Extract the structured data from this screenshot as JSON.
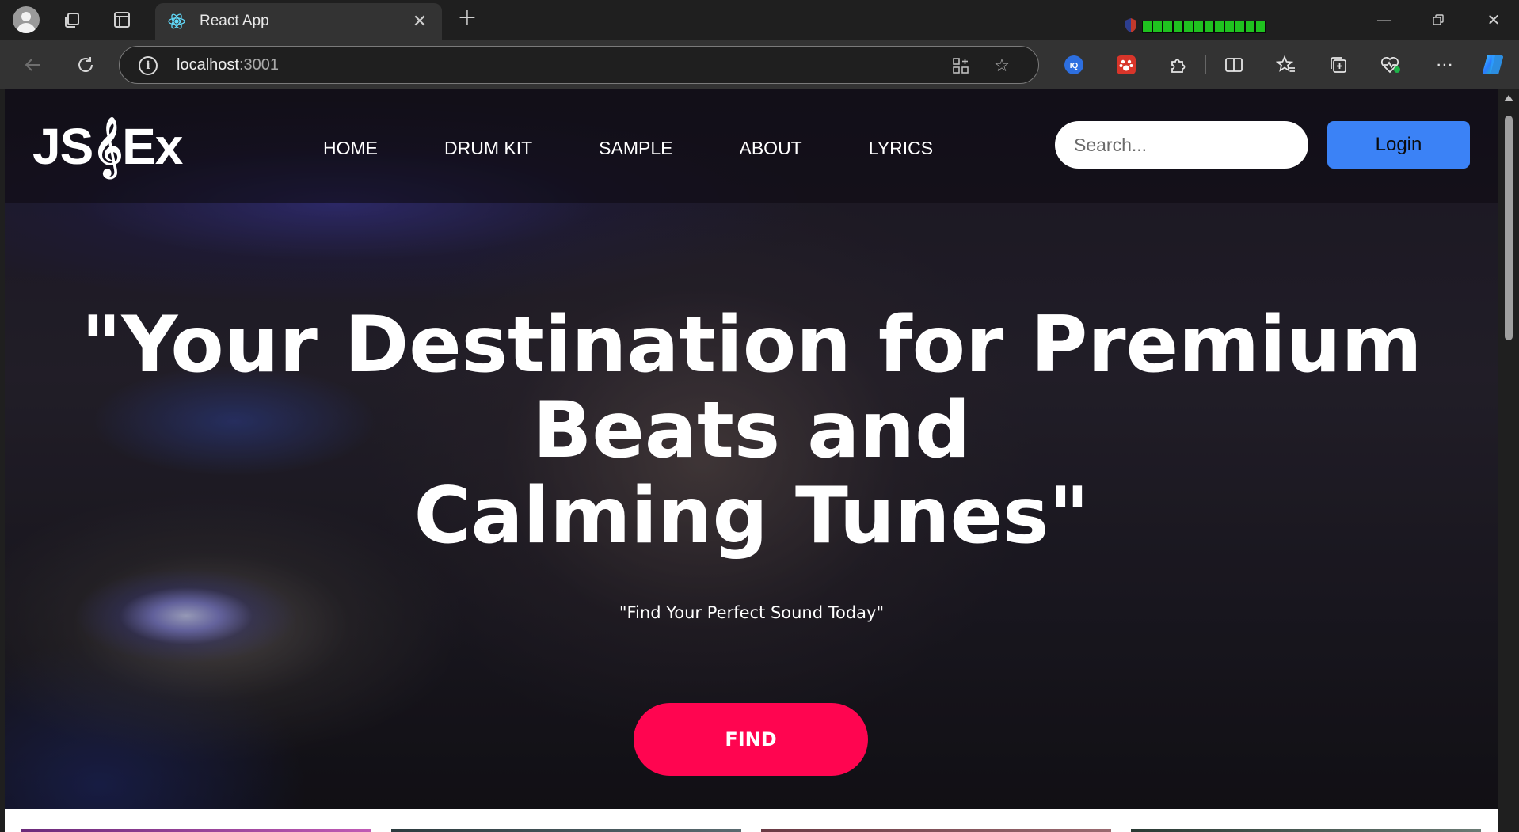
{
  "browser": {
    "tab_title": "React App",
    "url_host": "localhost",
    "url_port": ":3001",
    "icons": [
      "profile-icon",
      "workspaces-icon",
      "tab-actions-icon",
      "react-favicon-icon",
      "close-icon",
      "new-tab-icon",
      "minimize-icon",
      "restore-icon",
      "window-close-icon",
      "back-icon",
      "refresh-icon",
      "info-icon",
      "app-install-icon",
      "favorite-star-icon",
      "extension-iq-icon",
      "extension-paw-icon",
      "extensions-puzzle-icon",
      "split-screen-icon",
      "favorites-icon",
      "collections-icon",
      "browser-health-icon",
      "more-icon",
      "copilot-icon"
    ]
  },
  "page": {
    "logo": "JS𝄞Ex",
    "nav": [
      "HOME",
      "DRUM KIT",
      "SAMPLE",
      "ABOUT",
      "LYRICS"
    ],
    "search_placeholder": "Search...",
    "login_label": "Login",
    "headline_line1": "\"Your Destination for Premium",
    "headline_line2": "Beats and",
    "headline_line3": "Calming Tunes\"",
    "subheadline": "\"Find Your Perfect Sound Today\"",
    "find_label": "FIND"
  },
  "colors": {
    "login": "#3b82f6",
    "find": "#ff0550",
    "browser_bg": "#1f1f1f",
    "toolbar": "#333333"
  }
}
